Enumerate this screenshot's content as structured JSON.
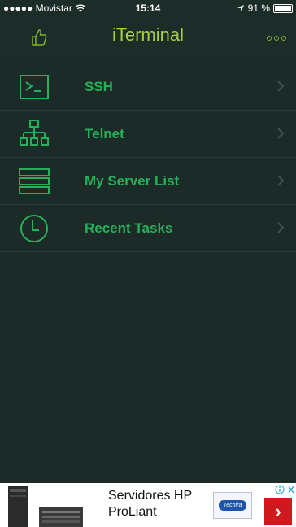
{
  "status_bar": {
    "carrier": "●●●●● Movistar",
    "time": "15:14",
    "battery": "91 %",
    "battery_level": 0.91
  },
  "nav": {
    "title": "iTerminal"
  },
  "menu": {
    "items": [
      {
        "label": "SSH",
        "icon": "terminal-icon"
      },
      {
        "label": "Telnet",
        "icon": "network-icon"
      },
      {
        "label": "My Server List",
        "icon": "server-list-icon"
      },
      {
        "label": "Recent Tasks",
        "icon": "clock-icon"
      }
    ]
  },
  "ad": {
    "line1": "Servidores HP",
    "line2": "ProLiant",
    "logo_text": "Tecnira"
  },
  "colors": {
    "background": "#1c2a28",
    "title": "#a6d23a",
    "accent": "#27b05a",
    "ad_button": "#d0191c"
  }
}
